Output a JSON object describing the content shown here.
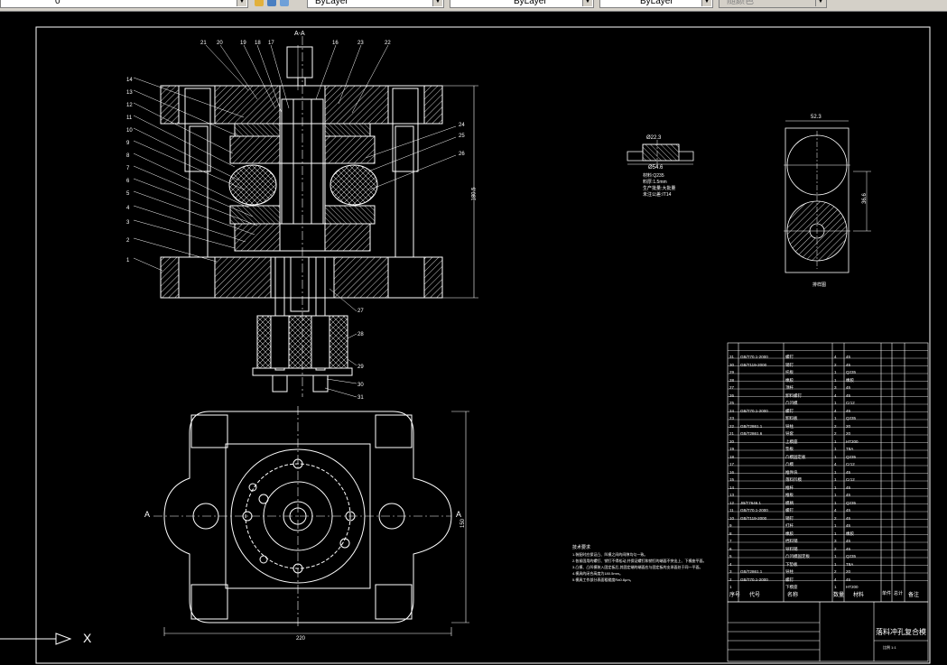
{
  "toolbar": {
    "layer_combo_value": "0",
    "color_combo_value": "ByLayer",
    "linetype_combo_value": "ByLayer",
    "lineweight_combo_value": "ByLayer",
    "plotstyle_combo_value": "随颜色"
  },
  "section_label": "A-A",
  "section_callouts_top": [
    "21",
    "20",
    "19",
    "18",
    "17",
    "16",
    "23",
    "22"
  ],
  "section_callouts_left": [
    "14",
    "13",
    "12",
    "11",
    "10",
    "9",
    "8",
    "7",
    "6",
    "5",
    "4",
    "3",
    "2",
    "1"
  ],
  "section_callouts_right": [
    "24",
    "25",
    "26",
    "27",
    "28",
    "29",
    "30",
    "31"
  ],
  "dims": {
    "section_height": "180.5",
    "plan_width": "220",
    "plan_height": "150",
    "strip_width": "52.3",
    "strip_pitch": "36.6",
    "part_outer": "Ø54.6",
    "part_inner": "Ø22.3"
  },
  "plan_labels": {
    "left": "A",
    "right": "A"
  },
  "part_notes": [
    "材料:Q235",
    "料厚:1.5mm",
    "生产批量:大批量",
    "未注公差:IT14"
  ],
  "strip_label": "排样图",
  "tech_requirements": {
    "title": "技术要求",
    "items": [
      "1.装配时应保证凸、凹模之间的间隙均匀一致。",
      "2.各紧固用的螺钉、销钉不得松动,并保证螺钉和销钉的端面不突出上、下模座平面。",
      "3.凸模、凸凹模装入固定板后,其固定端的端面应与固定板的支承面处于同一平面。",
      "4.模具的闭合高度为180.5mm。",
      "5.模具工作部分表面粗糙度Ra0.8μm。"
    ]
  },
  "bom": {
    "headers": [
      "序号",
      "代号",
      "名称",
      "数量",
      "材料",
      "单件",
      "总计",
      "备注"
    ],
    "rows": [
      {
        "no": "31",
        "code": "GB/T70.1-2000",
        "name": "螺钉",
        "qty": "4",
        "mat": "45",
        "note": ""
      },
      {
        "no": "30",
        "code": "GB/T119-2000",
        "name": "销钉",
        "qty": "2",
        "mat": "45",
        "note": ""
      },
      {
        "no": "29",
        "code": "",
        "name": "托板",
        "qty": "1",
        "mat": "Q235",
        "note": ""
      },
      {
        "no": "28",
        "code": "",
        "name": "橡胶",
        "qty": "1",
        "mat": "橡胶",
        "note": ""
      },
      {
        "no": "27",
        "code": "",
        "name": "顶杆",
        "qty": "3",
        "mat": "45",
        "note": ""
      },
      {
        "no": "26",
        "code": "",
        "name": "卸料螺钉",
        "qty": "4",
        "mat": "45",
        "note": ""
      },
      {
        "no": "25",
        "code": "",
        "name": "凸凹模",
        "qty": "1",
        "mat": "Cr12",
        "note": ""
      },
      {
        "no": "24",
        "code": "GB/T70.1-2000",
        "name": "螺钉",
        "qty": "4",
        "mat": "45",
        "note": ""
      },
      {
        "no": "23",
        "code": "",
        "name": "卸料板",
        "qty": "1",
        "mat": "Q235",
        "note": ""
      },
      {
        "no": "22",
        "code": "GB/T2861.1",
        "name": "导柱",
        "qty": "2",
        "mat": "20",
        "note": ""
      },
      {
        "no": "21",
        "code": "GB/T2861.6",
        "name": "导套",
        "qty": "2",
        "mat": "20",
        "note": ""
      },
      {
        "no": "20",
        "code": "",
        "name": "上模座",
        "qty": "1",
        "mat": "HT200",
        "note": ""
      },
      {
        "no": "19",
        "code": "",
        "name": "垫板",
        "qty": "1",
        "mat": "T8A",
        "note": ""
      },
      {
        "no": "18",
        "code": "",
        "name": "凸模固定板",
        "qty": "1",
        "mat": "Q235",
        "note": ""
      },
      {
        "no": "17",
        "code": "",
        "name": "凸模",
        "qty": "4",
        "mat": "Cr12",
        "note": ""
      },
      {
        "no": "16",
        "code": "",
        "name": "推件块",
        "qty": "1",
        "mat": "45",
        "note": ""
      },
      {
        "no": "15",
        "code": "",
        "name": "落料凹模",
        "qty": "1",
        "mat": "Cr12",
        "note": ""
      },
      {
        "no": "14",
        "code": "",
        "name": "推杆",
        "qty": "1",
        "mat": "45",
        "note": ""
      },
      {
        "no": "13",
        "code": "",
        "name": "推板",
        "qty": "1",
        "mat": "45",
        "note": ""
      },
      {
        "no": "12",
        "code": "JB/T7646.1",
        "name": "模柄",
        "qty": "1",
        "mat": "Q235",
        "note": ""
      },
      {
        "no": "11",
        "code": "GB/T70.1-2000",
        "name": "螺钉",
        "qty": "4",
        "mat": "45",
        "note": ""
      },
      {
        "no": "10",
        "code": "GB/T119-2000",
        "name": "销钉",
        "qty": "2",
        "mat": "45",
        "note": ""
      },
      {
        "no": "9",
        "code": "",
        "name": "打杆",
        "qty": "1",
        "mat": "45",
        "note": ""
      },
      {
        "no": "8",
        "code": "",
        "name": "橡胶",
        "qty": "1",
        "mat": "橡胶",
        "note": ""
      },
      {
        "no": "7",
        "code": "",
        "name": "挡料销",
        "qty": "3",
        "mat": "45",
        "note": ""
      },
      {
        "no": "6",
        "code": "",
        "name": "导料销",
        "qty": "2",
        "mat": "45",
        "note": ""
      },
      {
        "no": "5",
        "code": "",
        "name": "凸凹模固定板",
        "qty": "1",
        "mat": "Q235",
        "note": ""
      },
      {
        "no": "4",
        "code": "",
        "name": "下垫板",
        "qty": "1",
        "mat": "T8A",
        "note": ""
      },
      {
        "no": "3",
        "code": "GB/T2861.1",
        "name": "导柱",
        "qty": "2",
        "mat": "20",
        "note": ""
      },
      {
        "no": "2",
        "code": "GB/T70.1-2000",
        "name": "螺钉",
        "qty": "4",
        "mat": "45",
        "note": ""
      },
      {
        "no": "1",
        "code": "",
        "name": "下模座",
        "qty": "1",
        "mat": "HT200",
        "note": ""
      }
    ]
  },
  "title_block": {
    "drawing_title": "落料冲孔复合模",
    "scale": "比例 1:1"
  },
  "ucs": {
    "x_label": "X"
  }
}
